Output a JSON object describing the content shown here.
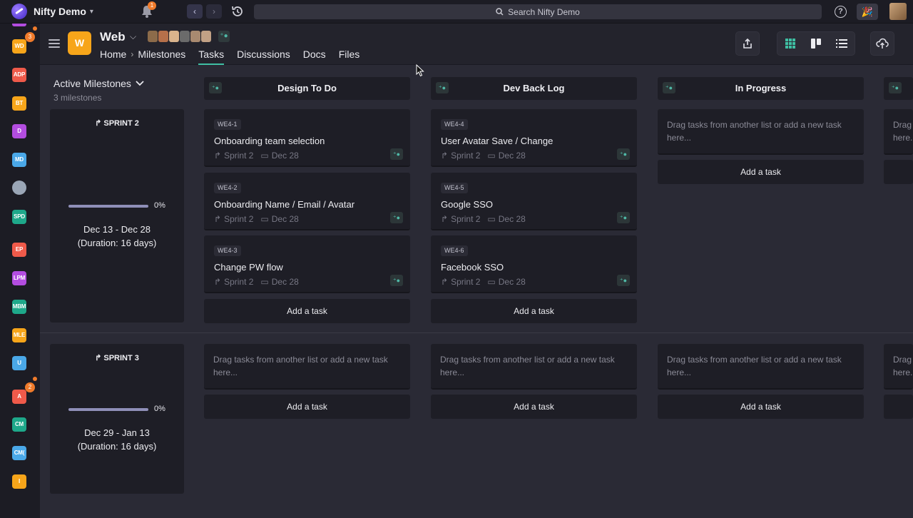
{
  "app": {
    "name": "Nifty Demo",
    "notifications_count": "1",
    "search_placeholder": "Search Nifty Demo",
    "help_label": "?"
  },
  "rail": {
    "items": [
      {
        "label": "WD",
        "color": "#f7a51a",
        "badge": "3"
      },
      {
        "label": "ADP",
        "color": "#ef5a4a"
      },
      {
        "label": "BT",
        "color": "#f7a51a"
      },
      {
        "label": "D",
        "color": "#b34de0"
      },
      {
        "label": "MD",
        "color": "#4aa8e8"
      },
      {
        "label": "",
        "color": "#9aa6b6"
      },
      {
        "label": "SPD",
        "color": "#1ea88a"
      },
      {
        "label": "EP",
        "color": "#ef5a4a"
      },
      {
        "label": "LPM",
        "color": "#b34de0"
      },
      {
        "label": "MBM",
        "color": "#1ea88a"
      },
      {
        "label": "MLE",
        "color": "#f7a51a"
      },
      {
        "label": "U",
        "color": "#4aa8e8"
      },
      {
        "label": "A",
        "color": "#ef5a4a",
        "badge": "2"
      },
      {
        "label": "CM",
        "color": "#1ea88a"
      },
      {
        "label": "CM(",
        "color": "#4aa8e8"
      },
      {
        "label": "I",
        "color": "#f7a51a"
      }
    ]
  },
  "project": {
    "icon_letter": "W",
    "title": "Web",
    "nav": {
      "home": "Home",
      "milestones": "Milestones",
      "tasks": "Tasks",
      "discussions": "Discussions",
      "docs": "Docs",
      "files": "Files"
    }
  },
  "milestones": {
    "filter_label": "Active Milestones",
    "count_label": "3 milestones",
    "sprints": [
      {
        "name": "SPRINT 2",
        "progress_pct": 0,
        "progress_label": "0%",
        "dates": "Dec 13 - Dec 28",
        "duration": "(Duration: 16 days)"
      },
      {
        "name": "SPRINT 3",
        "progress_pct": 0,
        "progress_label": "0%",
        "dates": "Dec 29 - Jan 13",
        "duration": "(Duration: 16 days)"
      }
    ]
  },
  "columns": [
    {
      "title": "Design To Do"
    },
    {
      "title": "Dev Back Log"
    },
    {
      "title": "In Progress"
    }
  ],
  "tasks": {
    "design": [
      {
        "id": "WE4-1",
        "title": "Onboarding team selection",
        "milestone": "Sprint 2",
        "due": "Dec 28"
      },
      {
        "id": "WE4-2",
        "title": "Onboarding Name / Email / Avatar",
        "milestone": "Sprint 2",
        "due": "Dec 28"
      },
      {
        "id": "WE4-3",
        "title": "Change PW flow",
        "milestone": "Sprint 2",
        "due": "Dec 28"
      }
    ],
    "dev": [
      {
        "id": "WE4-4",
        "title": "User Avatar Save / Change",
        "milestone": "Sprint 2",
        "due": "Dec 28"
      },
      {
        "id": "WE4-5",
        "title": "Google SSO",
        "milestone": "Sprint 2",
        "due": "Dec 28"
      },
      {
        "id": "WE4-6",
        "title": "Facebook SSO",
        "milestone": "Sprint 2",
        "due": "Dec 28"
      }
    ]
  },
  "labels": {
    "add_task": "Add a task",
    "drop_hint": "Drag tasks from another list or add a new task here...",
    "drop_hint_partial": "Drag\nhere.."
  },
  "colors": {
    "accent": "#3fbfa3",
    "project_icon": "#f7a51a",
    "badge": "#f07b2b"
  }
}
